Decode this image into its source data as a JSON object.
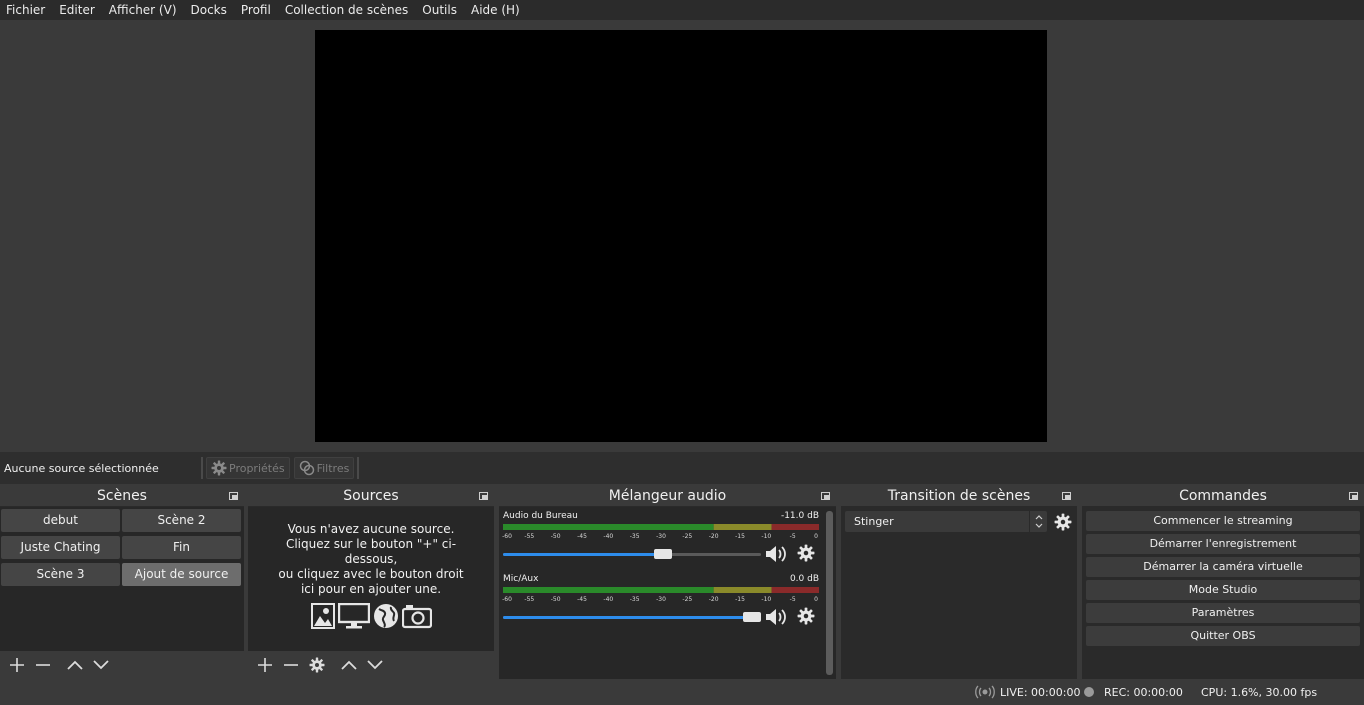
{
  "menu": [
    "Fichier",
    "Editer",
    "Afficher (V)",
    "Docks",
    "Profil",
    "Collection de scènes",
    "Outils",
    "Aide (H)"
  ],
  "source_toolbar": {
    "no_source": "Aucune source sélectionnée",
    "properties": "Propriétés",
    "filters": "Filtres"
  },
  "scenes": {
    "title": "Scènes",
    "items": [
      "debut",
      "Scène 2",
      "Juste Chating",
      "Fin",
      "Scène 3",
      "Ajout de source"
    ],
    "active": "Ajout de source"
  },
  "sources": {
    "title": "Sources",
    "empty_lines": [
      "Vous n'avez aucune source.",
      "Cliquez sur le bouton \"+\" ci-",
      "dessous,",
      "ou cliquez avec le bouton droit",
      "ici pour en ajouter une."
    ]
  },
  "mixer": {
    "title": "Mélangeur audio",
    "ticks": [
      "-60",
      "-55",
      "-50",
      "-45",
      "-40",
      "-35",
      "-30",
      "-25",
      "-20",
      "-15",
      "-10",
      "-5",
      "0"
    ],
    "channels": [
      {
        "name": "Audio du Bureau",
        "db": "-11.0 dB",
        "volume": 0.62
      },
      {
        "name": "Mic/Aux",
        "db": "0.0 dB",
        "volume": 1.0
      }
    ]
  },
  "transitions": {
    "title": "Transition de scènes",
    "selected": "Stinger"
  },
  "commands": {
    "title": "Commandes",
    "buttons": [
      "Commencer le streaming",
      "Démarrer l'enregistrement",
      "Démarrer la caméra virtuelle",
      "Mode Studio",
      "Paramètres",
      "Quitter OBS"
    ]
  },
  "status": {
    "live": "LIVE: 00:00:00",
    "rec": "REC: 00:00:00",
    "cpu": "CPU: 1.6%, 30.00 fps"
  },
  "colors": {
    "meter_green": "#2a8a2a",
    "meter_yellow": "#8a8a2a",
    "meter_red": "#8a2a2a",
    "slider_blue": "#2d8ceb"
  }
}
